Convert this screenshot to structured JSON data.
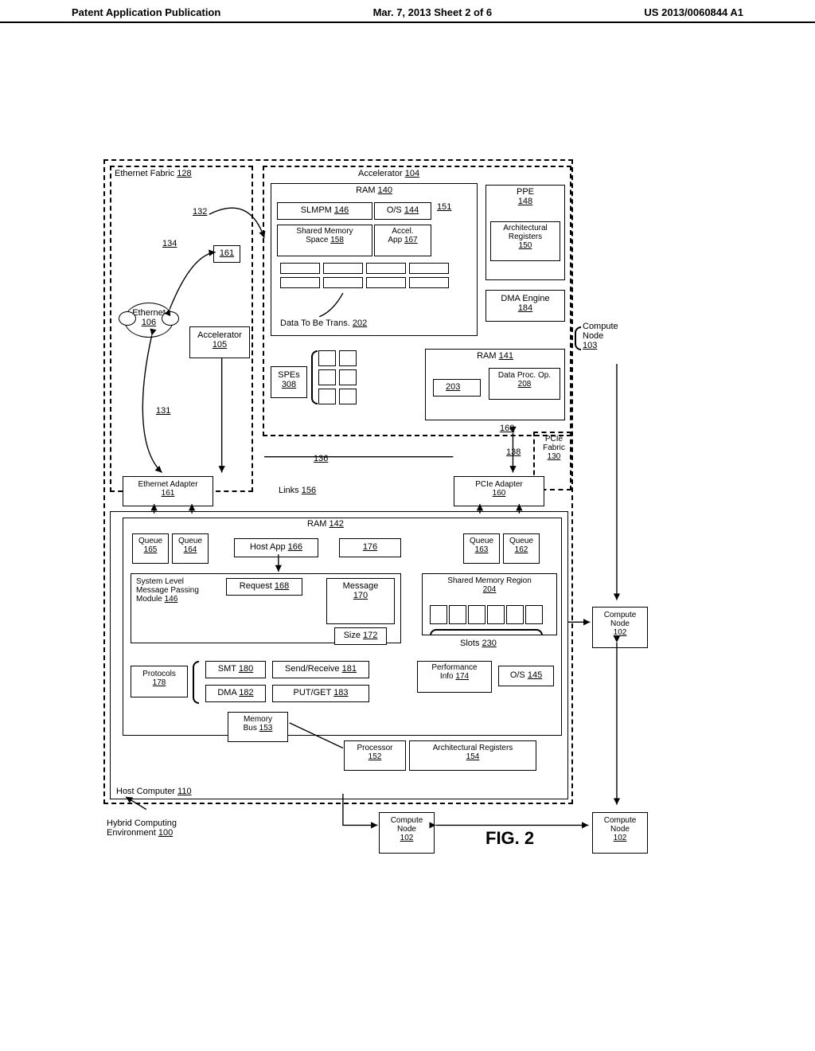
{
  "header": {
    "left": "Patent Application Publication",
    "center": "Mar. 7, 2013  Sheet 2 of 6",
    "right": "US 2013/0060844 A1"
  },
  "figure_label": "FIG. 2",
  "hybrid_env": {
    "label": "Hybrid Computing",
    "sub": "Environment",
    "ref": "100"
  },
  "ethernet_fabric": {
    "label": "Ethernet Fabric",
    "ref": "128"
  },
  "ethernet_cloud": {
    "label": "Ethernet",
    "ref": "106"
  },
  "link_132": "132",
  "link_134": "134",
  "link_131": "131",
  "acc_161_small": "161",
  "accelerator_105": {
    "label": "Accelerator",
    "ref": "105"
  },
  "accelerator_104": {
    "label": "Accelerator",
    "ref": "104"
  },
  "ram_140": {
    "label": "RAM",
    "ref": "140"
  },
  "slmpm_146": {
    "label": "SLMPM",
    "ref": "146"
  },
  "os_144": {
    "label": "O/S",
    "ref": "144"
  },
  "shared_mem_158": {
    "label": "Shared Memory",
    "sub": "Space",
    "ref": "158"
  },
  "accel_app_167": {
    "label1": "Accel.",
    "label2": "App",
    "ref": "167"
  },
  "data_trans": {
    "label": "Data To Be Trans.",
    "ref": "202"
  },
  "ppe_148": {
    "label": "PPE",
    "ref": "148"
  },
  "ref_151": "151",
  "arch_reg_150": {
    "label1": "Architectural",
    "label2": "Registers",
    "ref": "150"
  },
  "dma_engine_184": {
    "label": "DMA Engine",
    "ref": "184"
  },
  "compute_node_103": {
    "label1": "Compute",
    "label2": "Node",
    "ref": "103"
  },
  "ram_141": {
    "label": "RAM",
    "ref": "141"
  },
  "spes_308": {
    "label": "SPEs",
    "ref": "308"
  },
  "ref_203": "203",
  "data_proc_op_208": {
    "label": "Data Proc. Op.",
    "ref": "208"
  },
  "pcie_fabric": {
    "label1": "PCIe",
    "label2": "Fabric",
    "ref": "130"
  },
  "link_136": "136",
  "link_138": "138",
  "links_156": {
    "label": "Links",
    "ref": "156"
  },
  "eth_adapter_161": {
    "label": "Ethernet Adapter",
    "ref": "161"
  },
  "pcie_adapter_160": {
    "label": "PCIe Adapter",
    "ref": "160"
  },
  "ref_160_top": "160",
  "ram_142": {
    "label": "RAM",
    "ref": "142"
  },
  "queue_165": {
    "label": "Queue",
    "ref": "165"
  },
  "queue_164": {
    "label": "Queue",
    "ref": "164"
  },
  "queue_163": {
    "label": "Queue",
    "ref": "163"
  },
  "queue_162": {
    "label": "Queue",
    "ref": "162"
  },
  "host_app_166": {
    "label": "Host App",
    "ref": "166"
  },
  "ref_176": "176",
  "slmpm_module_146": {
    "label1": "System Level",
    "label2": "Message Passing",
    "label3": "Module",
    "ref": "146"
  },
  "request_168": {
    "label": "Request",
    "ref": "168"
  },
  "message_170": {
    "label": "Message",
    "ref": "170"
  },
  "size_172": {
    "label": "Size",
    "ref": "172"
  },
  "shared_mem_region_204": {
    "label": "Shared Memory Region",
    "ref": "204"
  },
  "slots_230": {
    "label": "Slots",
    "ref": "230"
  },
  "protocols_178": {
    "label": "Protocols",
    "ref": "178"
  },
  "smt_180": {
    "label": "SMT",
    "ref": "180"
  },
  "dma_182": {
    "label": "DMA",
    "ref": "182"
  },
  "send_recv_181": {
    "label": "Send/Receive",
    "ref": "181"
  },
  "put_get_183": {
    "label": "PUT/GET",
    "ref": "183"
  },
  "perf_info_174": {
    "label1": "Performance",
    "label2": "Info",
    "ref": "174"
  },
  "os_145": {
    "label": "O/S",
    "ref": "145"
  },
  "memory_bus_153": {
    "label1": "Memory",
    "label2": "Bus",
    "ref": "153"
  },
  "processor_152": {
    "label": "Processor",
    "ref": "152"
  },
  "arch_reg_154": {
    "label": "Architectural Registers",
    "ref": "154"
  },
  "host_computer_110": {
    "label": "Host Computer",
    "ref": "110"
  },
  "compute_node_102_a": {
    "label1": "Compute",
    "label2": "Node",
    "ref": "102"
  },
  "compute_node_102_b": {
    "label1": "Compute",
    "label2": "Node",
    "ref": "102"
  },
  "compute_node_102_c": {
    "label1": "Compute",
    "label2": "Node",
    "ref": "102"
  }
}
